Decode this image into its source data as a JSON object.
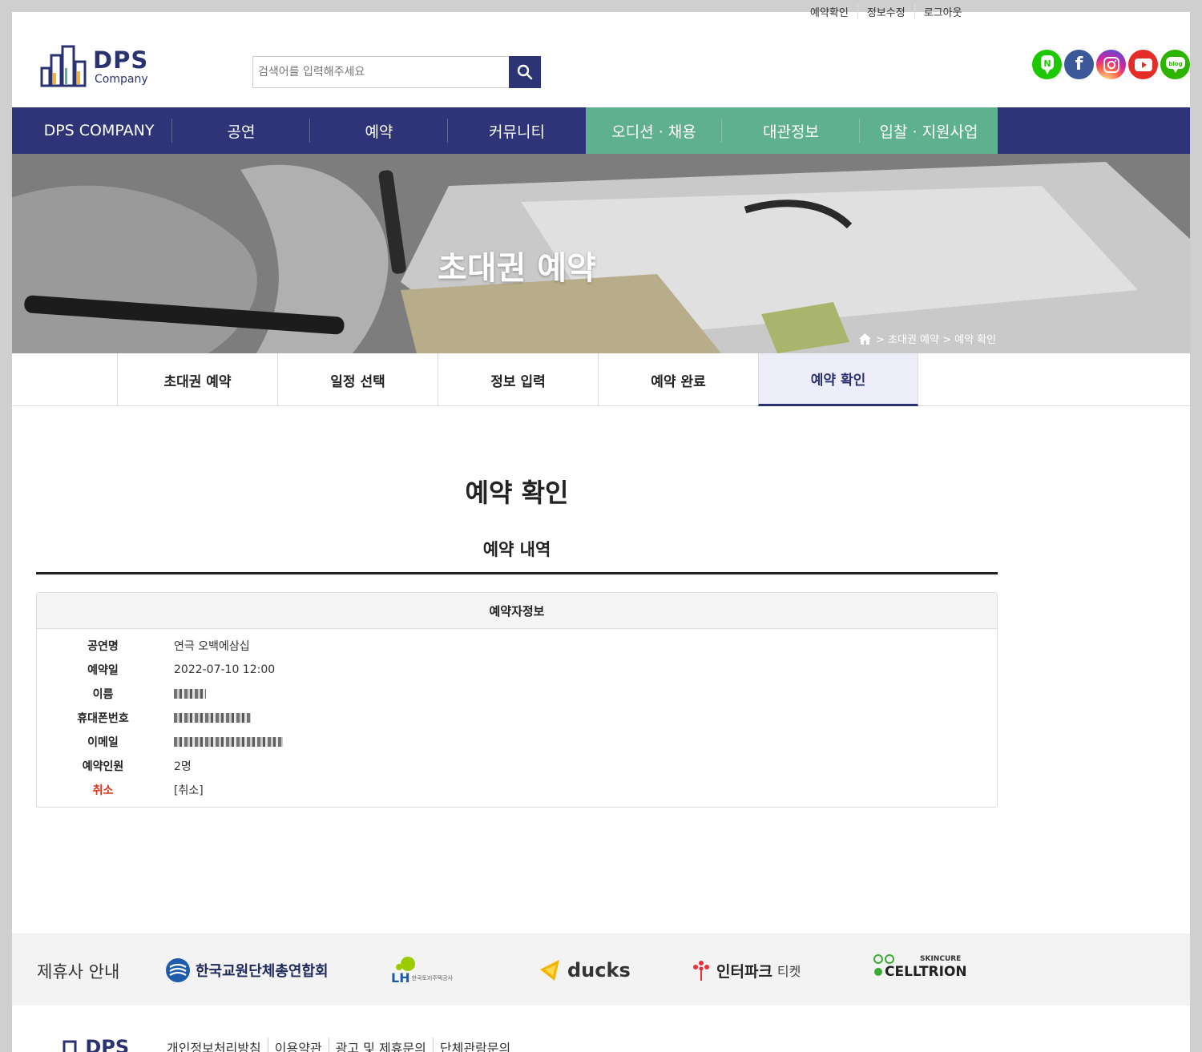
{
  "top_links": [
    "예약확인",
    "정보수정",
    "로그아웃"
  ],
  "logo": {
    "name": "DPS",
    "sub": "Company"
  },
  "search": {
    "placeholder": "검색어를 입력해주세요"
  },
  "social": [
    {
      "icon": "naver-icon",
      "color": "#1ec800",
      "glyph": "N"
    },
    {
      "icon": "facebook-icon",
      "color": "#3b5998",
      "glyph": "f"
    },
    {
      "icon": "instagram-icon",
      "color": "#c13584",
      "glyph": "◎"
    },
    {
      "icon": "youtube-icon",
      "color": "#e52d27",
      "glyph": "▶"
    },
    {
      "icon": "blog-icon",
      "color": "#2db400",
      "glyph": "blog"
    }
  ],
  "nav": [
    "DPS COMPANY",
    "공연",
    "예약",
    "커뮤니티",
    "오디션 · 채용",
    "대관정보",
    "입찰 · 지원사업"
  ],
  "hero": {
    "title": "초대권 예약",
    "breadcrumb": "> 초대권 예약 > 예약 확인"
  },
  "tabs": [
    "초대권 예약",
    "일정 선택",
    "정보 입력",
    "예약 완료",
    "예약 확인"
  ],
  "page": {
    "title": "예약 확인",
    "section": "예약 내역"
  },
  "card": {
    "header": "예약자정보",
    "rows": [
      {
        "label": "공연명",
        "value": "연극 오백에삼십"
      },
      {
        "label": "예약일",
        "value": "2022-07-10 12:00"
      },
      {
        "label": "이름",
        "value": ""
      },
      {
        "label": "휴대폰번호",
        "value": ""
      },
      {
        "label": "이메일",
        "value": ""
      },
      {
        "label": "예약인원",
        "value": "2명"
      },
      {
        "label": "취소",
        "value": "[취소]"
      }
    ]
  },
  "partners": {
    "label": "제휴사 안내",
    "items": [
      "한국교원단체총연합회",
      "LH",
      "한국토지주택공사",
      "ducks",
      "인터파크",
      "티켓",
      "SKINCURE",
      "CELLTRION"
    ]
  },
  "footer": {
    "logo": "DPS",
    "links": [
      "개인정보처리방침",
      "이용약관",
      "광고 및 제휴문의",
      "단체관람문의"
    ]
  },
  "colors": {
    "primary": "#2e3477",
    "accent_green": "#5fb08f",
    "cancel_red": "#e0341c"
  }
}
